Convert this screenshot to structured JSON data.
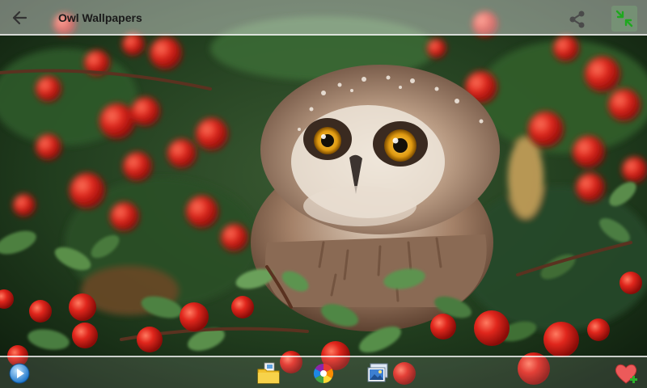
{
  "app": {
    "title": "Owl Wallpapers"
  },
  "toolbar": {
    "icons": [
      "back-arrow-icon",
      "share-icon",
      "fullscreen-toggle-icon"
    ]
  },
  "bottom_bar": {
    "icons": [
      "play-icon",
      "folder-icon",
      "color-wheel-icon",
      "gallery-icon",
      "favorite-add-icon"
    ]
  },
  "colors": {
    "topbar_tint": "#ffffff",
    "berry_red": "#d6201a",
    "foliage_green": "#2e5a2a",
    "owl_brown": "#7a5a44",
    "eye_amber": "#e0a020",
    "favorite_red": "#e84b4b",
    "favorite_plus_green": "#2bb02b"
  }
}
